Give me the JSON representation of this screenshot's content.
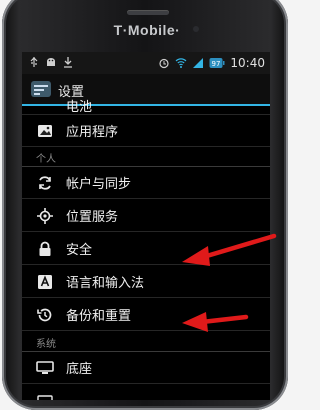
{
  "device": {
    "brand": "T·Mobile·"
  },
  "statusbar": {
    "time": "10:40",
    "battery_level": "97"
  },
  "actionbar": {
    "title": "设置"
  },
  "settings": {
    "partial_item": "电池",
    "apps_item": "应用程序",
    "section_personal": "个人",
    "accounts_sync": "帐户与同步",
    "location": "位置服务",
    "security": "安全",
    "language_input": "语言和输入法",
    "backup_reset": "备份和重置",
    "section_system": "系统",
    "dock": "底座"
  },
  "annotations": {
    "arrow_color": "#e01a1a"
  }
}
